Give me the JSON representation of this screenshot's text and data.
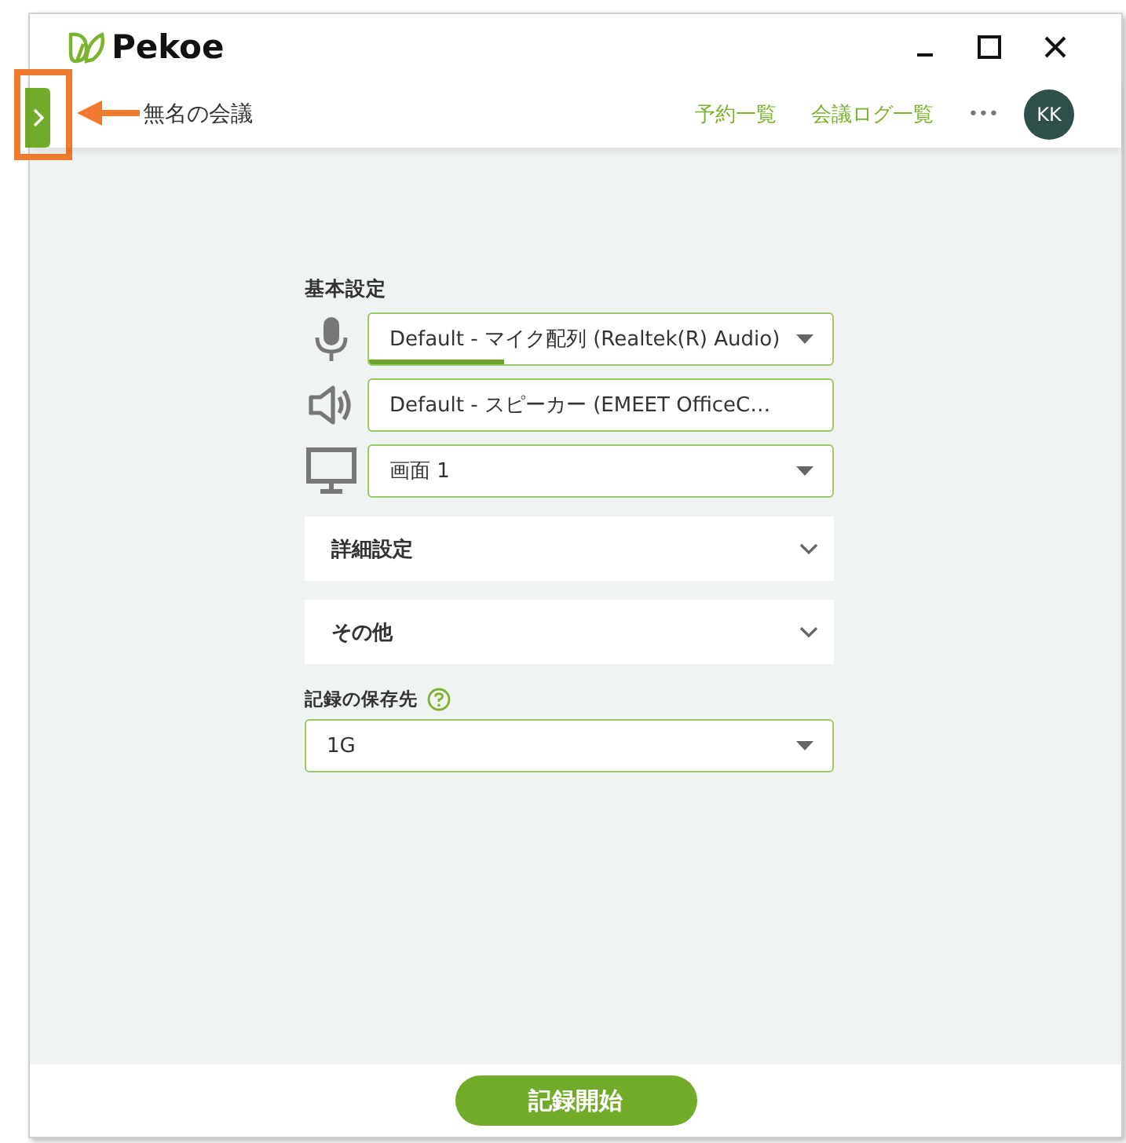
{
  "window": {
    "app_name": "Pekoe"
  },
  "header": {
    "meeting_title": "無名の会議",
    "links": [
      {
        "label": "予約一覧"
      },
      {
        "label": "会議ログ一覧"
      }
    ],
    "more": "•••",
    "avatar": "KK"
  },
  "settings": {
    "heading": "基本設定",
    "devices": [
      {
        "kind": "mic",
        "value": "Default - マイク配列 (Realtek(R) Audio)",
        "dropdown": true,
        "level": 0.29
      },
      {
        "kind": "speaker",
        "value": "Default - スピーカー (EMEET OfficeC…",
        "dropdown": false
      },
      {
        "kind": "screen",
        "value": "画面 1",
        "dropdown": true
      }
    ],
    "sections": [
      {
        "label": "詳細設定",
        "expanded": false
      },
      {
        "label": "その他",
        "expanded": false
      }
    ],
    "storage": {
      "label": "記録の保存先",
      "value": "1G"
    }
  },
  "footer": {
    "button": "記録開始"
  }
}
